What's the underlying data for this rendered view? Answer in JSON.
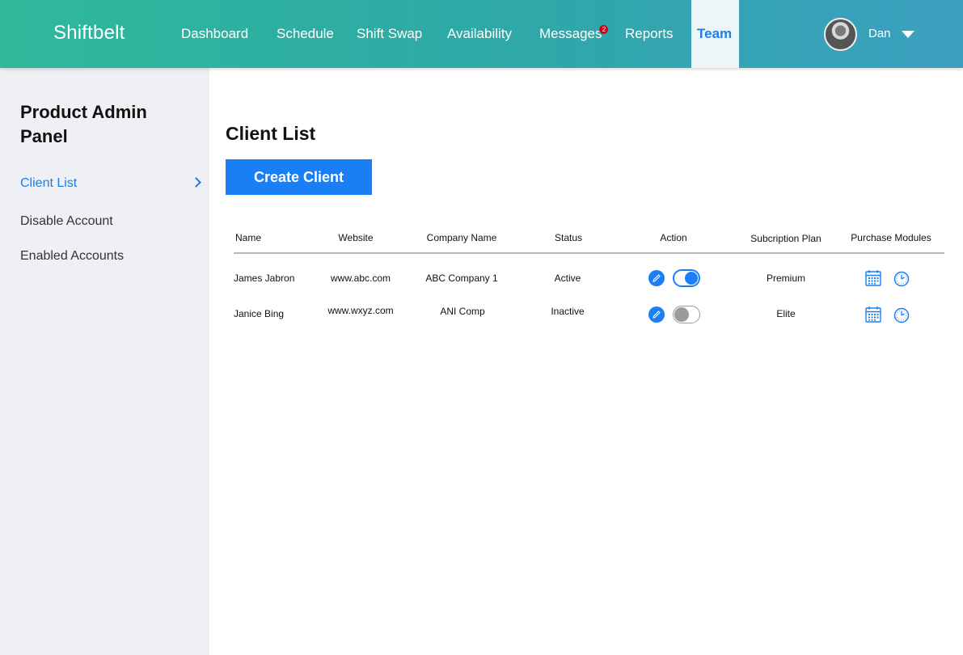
{
  "app": {
    "brand": "Shiftbelt"
  },
  "nav": {
    "items": [
      {
        "label": "Dashboard"
      },
      {
        "label": "Schedule"
      },
      {
        "label": "Shift Swap"
      },
      {
        "label": "Availability"
      },
      {
        "label": "Messages",
        "badge": "2"
      },
      {
        "label": "Reports"
      },
      {
        "label": "Team",
        "active": true
      }
    ]
  },
  "user": {
    "name": "Dan"
  },
  "sidebar": {
    "title": "Product Admin Panel",
    "items": [
      {
        "label": "Client List",
        "active": true
      },
      {
        "label": "Disable Account"
      },
      {
        "label": "Enabled Accounts"
      }
    ]
  },
  "main": {
    "title": "Client List",
    "create_button": "Create Client",
    "table": {
      "headers": {
        "name": "Name",
        "website": "Website",
        "company": "Company Name",
        "status": "Status",
        "action": "Action",
        "plan": "Subcription Plan",
        "modules": "Purchase Modules"
      },
      "rows": [
        {
          "name": "James Jabron",
          "website": "www.abc.com",
          "company": "ABC Company 1",
          "status": "Active",
          "enabled": true,
          "plan": "Premium",
          "module_icons": [
            "calendar-icon",
            "clock-icon"
          ]
        },
        {
          "name": "Janice Bing",
          "website": "www.wxyz.com",
          "company": "ANI Comp",
          "status": "Inactive",
          "enabled": false,
          "plan": "Elite",
          "module_icons": [
            "calendar-icon",
            "clock-icon"
          ]
        }
      ]
    }
  },
  "colors": {
    "accent": "#1a7ff5",
    "header_start": "#2fb89a",
    "header_end": "#3b9fc0",
    "badge": "#d0021b",
    "sidebar_bg": "#eff0f4"
  }
}
